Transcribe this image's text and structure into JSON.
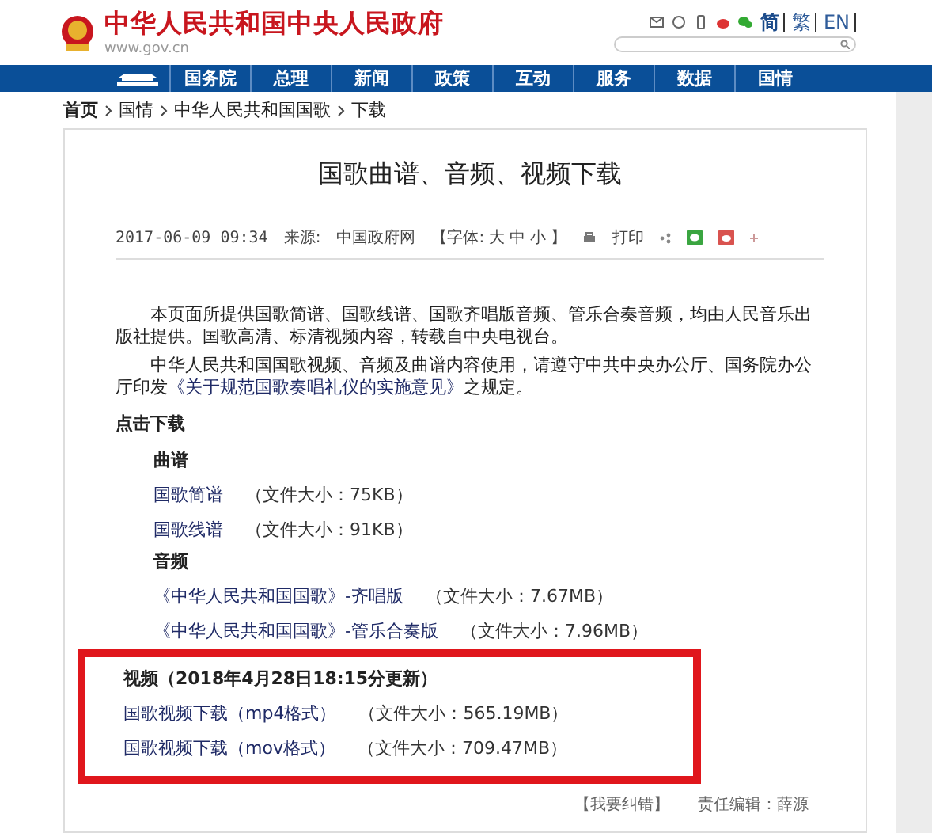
{
  "header": {
    "site_title": "中华人民共和国中央人民政府",
    "site_url": "www.gov.cn",
    "languages": [
      {
        "label": "简",
        "selected": true
      },
      {
        "label": "繁",
        "selected": false
      },
      {
        "label": "EN",
        "selected": false
      }
    ]
  },
  "nav": [
    "国务院",
    "总理",
    "新闻",
    "政策",
    "互动",
    "服务",
    "数据",
    "国情"
  ],
  "breadcrumb": [
    "首页",
    "国情",
    "中华人民共和国国歌",
    "下载"
  ],
  "article": {
    "title": "国歌曲谱、音频、视频下载",
    "date": "2017-06-09 09:34",
    "source_label": "来源:",
    "source": "中国政府网",
    "font_size": {
      "open": "【字体:",
      "sizes": [
        "大",
        "中",
        "小"
      ],
      "close": "】"
    },
    "print": "打印",
    "paragraphs": [
      {
        "text": "本页面所提供国歌简谱、国歌线谱、国歌齐唱版音频、管乐合奏音频，均由人民音乐出版社提供。国歌高清、标清视频内容，转载自中央电视台。"
      },
      {
        "text": "中华人民共和国国歌视频、音频及曲谱内容使用，请遵守中共中央办公厅、国务院办公厅印发",
        "link": "《关于规范国歌奏唱礼仪的实施意见》",
        "after": "之规定。"
      }
    ],
    "download_heading": "点击下载",
    "sections": [
      {
        "heading": "曲谱",
        "highlighted": false,
        "files": [
          {
            "name": "国歌简谱",
            "size": "（文件大小：75KB）"
          },
          {
            "name": "国歌线谱",
            "size": "（文件大小：91KB）"
          }
        ]
      },
      {
        "heading": "音频",
        "highlighted": false,
        "files": [
          {
            "name": "《中华人民共和国国歌》-齐唱版",
            "size": "（文件大小：7.67MB）"
          },
          {
            "name": "《中华人民共和国国歌》-管乐合奏版",
            "size": "（文件大小：7.96MB）"
          }
        ]
      },
      {
        "heading": "视频（2018年4月28日18:15分更新）",
        "highlighted": true,
        "files": [
          {
            "name": "国歌视频下载（mp4格式）",
            "size": "（文件大小：565.19MB）"
          },
          {
            "name": "国歌视频下载（mov格式）",
            "size": "（文件大小：709.47MB）"
          }
        ]
      }
    ],
    "report_error": "【我要纠错】",
    "editor": "责任编辑：薛源"
  }
}
